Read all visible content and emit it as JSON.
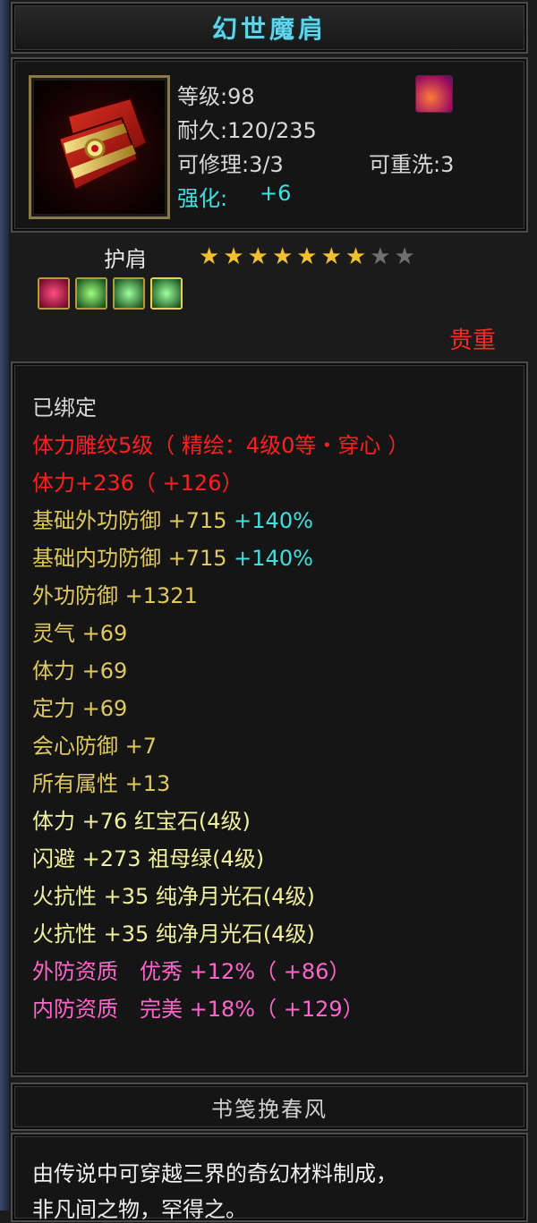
{
  "item": {
    "name": "幻世魔肩",
    "level": "等级:98",
    "durability": "耐久:120/235",
    "repair": "可修理:3/3",
    "rewash": "可重洗:3",
    "enhance_label": "强化:",
    "enhance_value": "+6",
    "type": "护肩",
    "stars_filled": 7,
    "stars_total": 9,
    "rarity": "贵重",
    "gem_slots": [
      "ruby",
      "green",
      "green",
      "green"
    ]
  },
  "attributes": [
    {
      "text": "已绑定",
      "color": "#d8d8d8"
    },
    {
      "text": "体力雕纹5级（ 精绘：4级0等・穿心 ）",
      "color": "#ff2020"
    },
    {
      "text": "体力+236（ +126）",
      "color": "#ff2020"
    },
    {
      "text": "基础外功防御 +715",
      "extra": "+140%",
      "color": "#e0c860",
      "extra_color": "#40e0e0"
    },
    {
      "text": "基础内功防御 +715",
      "extra": "+140%",
      "color": "#e0c860",
      "extra_color": "#40e0e0"
    },
    {
      "text": "外功防御 +1321",
      "color": "#e0c860"
    },
    {
      "text": "灵气 +69",
      "color": "#e0c860"
    },
    {
      "text": "体力 +69",
      "color": "#e0c860"
    },
    {
      "text": "定力 +69",
      "color": "#e0c860"
    },
    {
      "text": "会心防御 +7",
      "color": "#e0c860"
    },
    {
      "text": "所有属性 +13",
      "color": "#e0c860"
    },
    {
      "text": "体力 +76 红宝石(4级)",
      "color": "#f0f0a0"
    },
    {
      "text": "闪避 +273 祖母绿(4级)",
      "color": "#f0f0a0"
    },
    {
      "text": "火抗性 +35 纯净月光石(4级)",
      "color": "#f0f0a0"
    },
    {
      "text": "火抗性 +35 纯净月光石(4级)",
      "color": "#f0f0a0"
    },
    {
      "text": "外防资质　优秀 +12%（ +86）",
      "color": "#ff66cc"
    },
    {
      "text": "内防资质　完美 +18%（ +129）",
      "color": "#ff66cc"
    }
  ],
  "description": {
    "title": "书笺挽春风",
    "line1": "由传说中可穿越三界的奇幻材料制成，",
    "line2": "非凡间之物，罕得之。"
  },
  "colors": {
    "title": "#5fd3e8",
    "rarity": "#ff2a2a",
    "star": "#f0c030",
    "star_empty": "#707070"
  }
}
